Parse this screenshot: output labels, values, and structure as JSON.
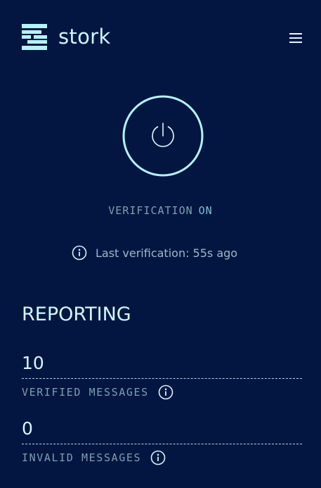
{
  "header": {
    "brand": "stork",
    "logo_icon": "stork-logo-icon",
    "menu_icon": "hamburger-menu-icon"
  },
  "colors": {
    "background": "#021641",
    "accent": "#b4f3f9",
    "muted_text": "#7f9fb0"
  },
  "verification": {
    "power_icon": "power-icon",
    "label": "VERIFICATION",
    "status": "ON",
    "info_icon": "info-icon",
    "last_verification": "Last verification: 55s ago"
  },
  "reporting": {
    "title": "REPORTING",
    "stats": [
      {
        "value": "10",
        "label": "VERIFIED MESSAGES",
        "icon": "info-icon"
      },
      {
        "value": "0",
        "label": "INVALID MESSAGES",
        "icon": "info-icon"
      }
    ]
  }
}
